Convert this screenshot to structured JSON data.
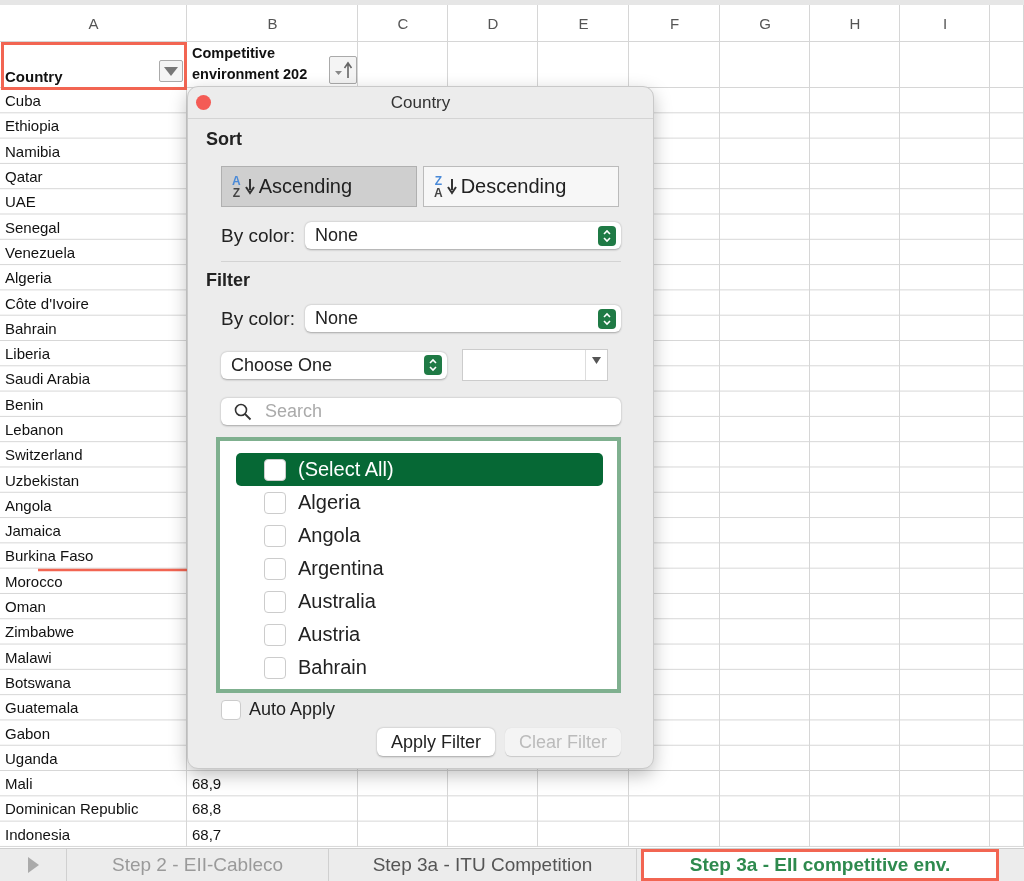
{
  "sheet": {
    "column_letters": [
      "A",
      "B",
      "C",
      "D",
      "E",
      "F",
      "G",
      "H",
      "I"
    ],
    "header": {
      "column_a": "Country",
      "column_b": "Competitive environment 202"
    },
    "rows": [
      {
        "country": "Cuba"
      },
      {
        "country": "Ethiopia"
      },
      {
        "country": "Namibia"
      },
      {
        "country": "Qatar"
      },
      {
        "country": "UAE"
      },
      {
        "country": "Senegal"
      },
      {
        "country": "Venezuela"
      },
      {
        "country": "Algeria"
      },
      {
        "country": "Côte d'Ivoire"
      },
      {
        "country": "Bahrain"
      },
      {
        "country": "Liberia"
      },
      {
        "country": "Saudi Arabia"
      },
      {
        "country": "Benin"
      },
      {
        "country": "Lebanon"
      },
      {
        "country": "Switzerland"
      },
      {
        "country": "Uzbekistan"
      },
      {
        "country": "Angola"
      },
      {
        "country": "Jamaica"
      },
      {
        "country": "Burkina Faso"
      },
      {
        "country": "Morocco"
      },
      {
        "country": "Oman"
      },
      {
        "country": "Zimbabwe"
      },
      {
        "country": "Malawi"
      },
      {
        "country": "Botswana"
      },
      {
        "country": "Guatemala"
      },
      {
        "country": "Gabon"
      },
      {
        "country": "Uganda"
      },
      {
        "country": "Mali",
        "column_b": "68,9"
      },
      {
        "country": "Dominican Republic",
        "column_b": "68,8"
      },
      {
        "country": "Indonesia",
        "column_b": "68,7"
      }
    ]
  },
  "filter_popup": {
    "title": "Country",
    "sort_heading": "Sort",
    "sort_buttons": [
      {
        "label": "Ascending",
        "icon_letters": [
          "A",
          "Z"
        ],
        "selected": true
      },
      {
        "label": "Descending",
        "icon_letters": [
          "Z",
          "A"
        ],
        "selected": false
      }
    ],
    "sort_by_color": {
      "label": "By color:",
      "value": "None"
    },
    "filter_heading": "Filter",
    "filter_by_color": {
      "label": "By color:",
      "value": "None"
    },
    "condition": {
      "value": "Choose One"
    },
    "search": {
      "placeholder": "Search"
    },
    "items": [
      {
        "label": "(Select All)",
        "checked": false,
        "selected": true
      },
      {
        "label": "Algeria",
        "checked": false,
        "selected": false
      },
      {
        "label": "Angola",
        "checked": false,
        "selected": false
      },
      {
        "label": "Argentina",
        "checked": false,
        "selected": false
      },
      {
        "label": "Australia",
        "checked": false,
        "selected": false
      },
      {
        "label": "Austria",
        "checked": false,
        "selected": false
      },
      {
        "label": "Bahrain",
        "checked": false,
        "selected": false
      }
    ],
    "auto_apply": {
      "label": "Auto Apply",
      "checked": false
    },
    "buttons": [
      {
        "label": "Apply Filter",
        "disabled": false
      },
      {
        "label": "Clear Filter",
        "disabled": true
      }
    ]
  },
  "sheet_tabs": [
    {
      "label": "Step 2 - EII-Cableco",
      "selected": false
    },
    {
      "label": "Step 3a - ITU Competition",
      "selected": false
    },
    {
      "label": "Step 3a - EII competitive env.",
      "selected": true
    }
  ]
}
